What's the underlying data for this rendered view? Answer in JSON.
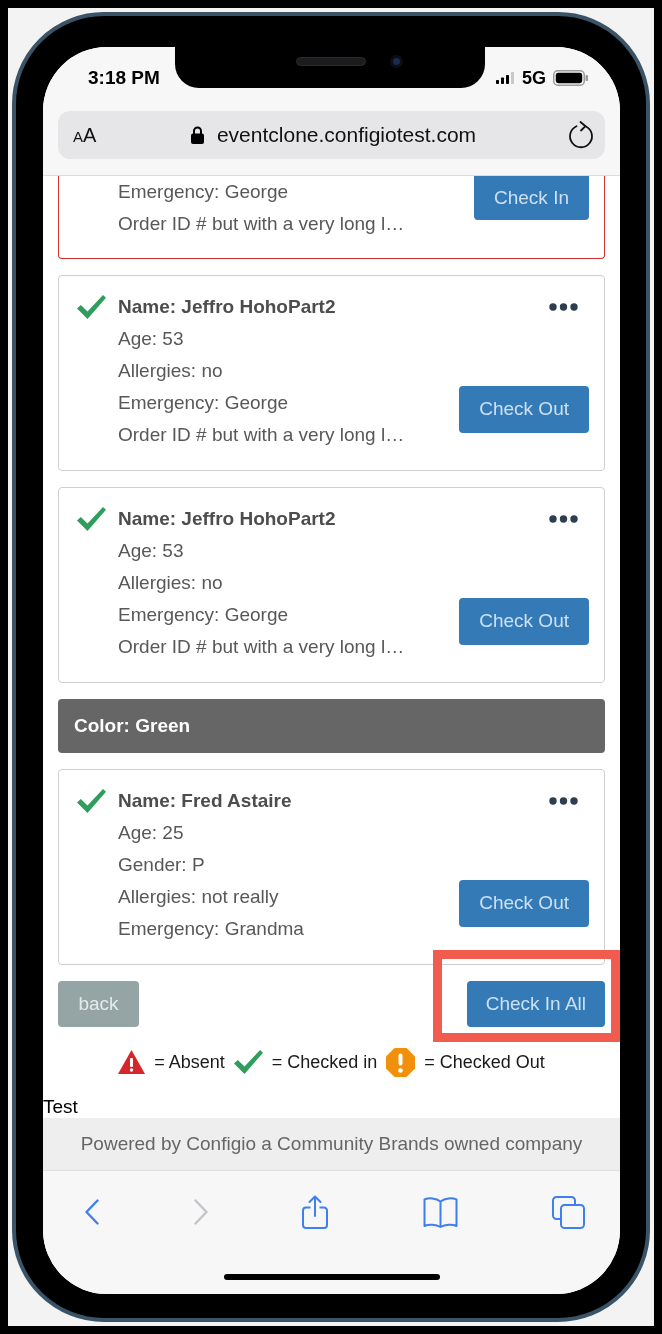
{
  "status_bar": {
    "time": "3:18 PM",
    "network": "5G"
  },
  "address_bar": {
    "text_size_button": "AA",
    "url": "eventclone.configiotest.com"
  },
  "list": [
    {
      "kind": "card",
      "flagged": true,
      "checked_in": false,
      "lines": [
        "Emergency: George",
        "Order ID # but with a very long l…"
      ],
      "button": "Check In"
    },
    {
      "kind": "card",
      "flagged": false,
      "checked_in": true,
      "name": "Name: Jeffro HohoPart2",
      "lines": [
        "Age: 53",
        "Allergies: no",
        "Emergency: George",
        "Order ID # but with a very long l…"
      ],
      "button": "Check Out"
    },
    {
      "kind": "card",
      "flagged": false,
      "checked_in": true,
      "name": "Name: Jeffro HohoPart2",
      "lines": [
        "Age: 53",
        "Allergies: no",
        "Emergency: George",
        "Order ID # but with a very long l…"
      ],
      "button": "Check Out"
    },
    {
      "kind": "group_header",
      "label": "Color: Green"
    },
    {
      "kind": "card",
      "flagged": false,
      "checked_in": true,
      "name": "Name: Fred Astaire",
      "lines": [
        "Age: 25",
        "Gender: P",
        "Allergies: not really",
        "Emergency: Grandma"
      ],
      "button": "Check Out"
    }
  ],
  "actions": [
    {
      "kind": "secondary",
      "label": "back",
      "highlighted": false
    },
    {
      "kind": "primary",
      "label": "Check In All",
      "highlighted": true
    }
  ],
  "legend": [
    {
      "kind": "absent",
      "label": "= Absent"
    },
    {
      "kind": "checked_in",
      "label": "= Checked in"
    },
    {
      "kind": "checked_out",
      "label": "= Checked Out"
    }
  ],
  "test_text": "Test",
  "footer": "Powered by Configio a Community Brands owned company",
  "toolbar": [
    {
      "kind": "back",
      "disabled": false
    },
    {
      "kind": "forward",
      "disabled": true
    },
    {
      "kind": "share",
      "disabled": false
    },
    {
      "kind": "bookmarks",
      "disabled": false
    },
    {
      "kind": "tabs",
      "disabled": false
    }
  ]
}
